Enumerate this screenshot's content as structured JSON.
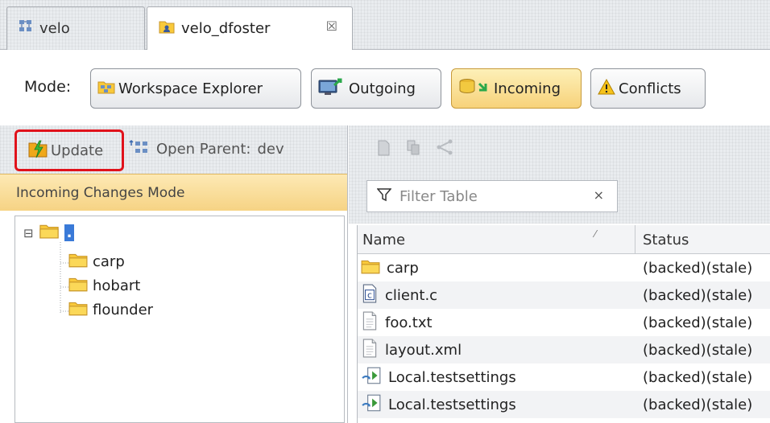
{
  "tabs": [
    {
      "label": "velo",
      "active": false,
      "icon": "workspace-icon"
    },
    {
      "label": "velo_dfoster",
      "active": true,
      "icon": "workspace-user-icon",
      "close": "☒"
    }
  ],
  "mode_bar": {
    "label": "Mode:",
    "buttons": [
      {
        "label": "Workspace Explorer",
        "icon": "workspace-explorer-icon",
        "selected": false
      },
      {
        "label": "Outgoing",
        "icon": "outgoing-icon",
        "selected": false
      },
      {
        "label": "Incoming",
        "icon": "incoming-icon",
        "selected": true
      },
      {
        "label": "Conflicts",
        "icon": "warning-icon",
        "selected": false
      }
    ]
  },
  "left_toolbar": {
    "update_label": "Update",
    "open_parent_label": "Open Parent:",
    "parent_name": "dev"
  },
  "left_header": "Incoming Changes Mode",
  "tree": {
    "root": {
      "label": ".",
      "expander": "⊟"
    },
    "children": [
      "carp",
      "hobart",
      "flounder"
    ]
  },
  "filter": {
    "placeholder": "Filter Table",
    "clear": "×"
  },
  "table": {
    "columns": {
      "name": "Name",
      "status": "Status"
    },
    "sort_indicator": "⁄",
    "rows": [
      {
        "name": "carp",
        "status": "(backed)(stale)",
        "icon": "folder-icon"
      },
      {
        "name": "client.c",
        "status": "(backed)(stale)",
        "icon": "c-file-icon"
      },
      {
        "name": "foo.txt",
        "status": "(backed)(stale)",
        "icon": "text-file-icon"
      },
      {
        "name": "layout.xml",
        "status": "(backed)(stale)",
        "icon": "text-file-icon"
      },
      {
        "name": "Local.testsettings",
        "status": "(backed)(stale)",
        "icon": "testsettings-icon"
      },
      {
        "name": "Local.testsettings",
        "status": "(backed)(stale)",
        "icon": "testsettings-icon"
      }
    ]
  },
  "colors": {
    "highlight_border": "#e0121b",
    "incoming_bg": "#f7d27a",
    "header_bg": "#fde9b4"
  }
}
